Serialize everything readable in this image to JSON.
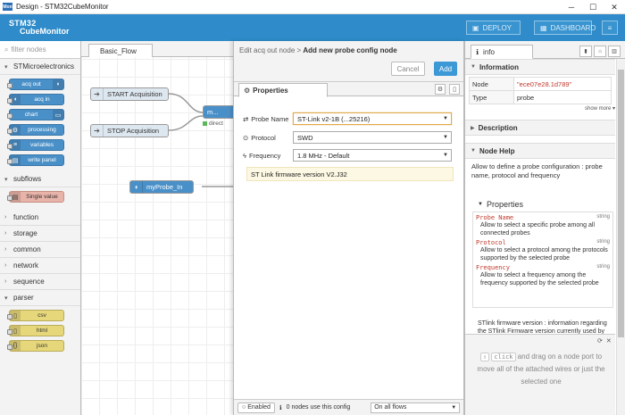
{
  "window": {
    "title": "Design - STM32CubeMonitor",
    "icon": "app-icon",
    "min": "─",
    "max": "☐",
    "close": "✕"
  },
  "header": {
    "logo_line1": "STM32",
    "logo_line2": "CubeMonitor",
    "deploy_label": "DEPLOY",
    "dashboard_label": "DASHBOARD"
  },
  "palette": {
    "filter_placeholder": "filter nodes",
    "categories": {
      "st": "STMicroelectronics",
      "subflows": "subflows",
      "function": "function",
      "storage": "storage",
      "common": "common",
      "network": "network",
      "sequence": "sequence",
      "parser": "parser"
    },
    "st_nodes": [
      "acq out",
      "acq in",
      "chart",
      "processing",
      "variables",
      "write panel"
    ],
    "subflow_nodes": [
      "Single value"
    ],
    "parser_nodes": [
      "csv",
      "html",
      "json"
    ]
  },
  "workspace": {
    "flow_tab": "Basic_Flow",
    "nodes": {
      "start": "START Acquisition",
      "stop": "STOP Acquisition",
      "probe_in": "myProbe_In",
      "right_partial": "m...",
      "direct": "direct"
    }
  },
  "tray": {
    "breadcrumb_prefix": "Edit acq out node > ",
    "breadcrumb_current": "Add new probe config node",
    "cancel_label": "Cancel",
    "add_label": "Add",
    "properties_tab": "Properties",
    "fields": {
      "probe_name": {
        "label": "Probe Name",
        "value": "ST-Link v2-1B (...25216)"
      },
      "protocol": {
        "label": "Protocol",
        "value": "SWD"
      },
      "frequency": {
        "label": "Frequency",
        "value": "1.8 MHz - Default"
      }
    },
    "firmware_text": "ST Link firmware version V2.J32",
    "footer": {
      "enabled": "Enabled",
      "nodes_use": "0 nodes use this config",
      "scope": "On all flows"
    }
  },
  "sidebar": {
    "tab_label": "info",
    "information_title": "Information",
    "node_key": "Node",
    "node_value": "\"ece07e28.1d789\"",
    "type_key": "Type",
    "type_value": "probe",
    "show_more": "show more",
    "description_title": "Description",
    "help_title": "Node Help",
    "help_text": "Allow to define a probe configuration : probe name, protocol and frequency",
    "properties_title": "Properties",
    "properties": [
      {
        "name": "Probe Name",
        "type": "string",
        "desc": "Allow to select a specific probe among all connected probes"
      },
      {
        "name": "Protocol",
        "type": "string",
        "desc": "Allow to select a protocol among the protocols supported by the selected probe"
      },
      {
        "name": "Frequency",
        "type": "string",
        "desc": "Allow to select a frequency among the frequency supported by the selected probe"
      }
    ],
    "stlink_text": "STlink firmware version : information regarding the STlink Firmware version currently used by",
    "tip": {
      "key": "⇧",
      "click": "click",
      "text": "and drag on a node port to move all of the attached wires or just the selected one"
    }
  },
  "colors": {
    "header": "#2f8bc9",
    "add_button": "#3d98d6",
    "node_blue": "#4a90c8",
    "node_yellow": "#e6d77a",
    "node_pink": "#e8b3a8"
  }
}
